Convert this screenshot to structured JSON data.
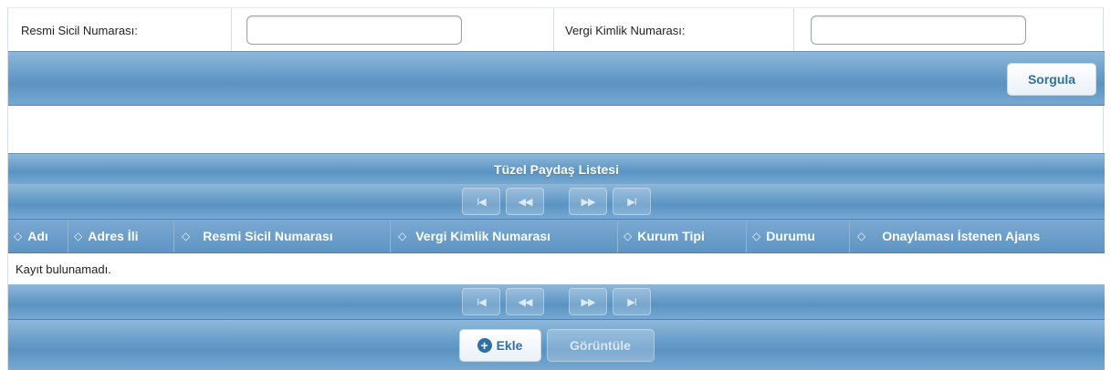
{
  "form": {
    "sicil_label": "Resmi Sicil Numarası:",
    "sicil_value": "",
    "vergi_label": "Vergi Kimlik Numarası:",
    "vergi_value": ""
  },
  "query_bar": {
    "sorgula_label": "Sorgula"
  },
  "list": {
    "title": "Tüzel Paydaş Listesi",
    "pager": {
      "first": "I◀",
      "prev": "◀◀",
      "next": "▶▶",
      "last": "▶I"
    },
    "columns": [
      {
        "label": "Adı",
        "sort_icon": "◇"
      },
      {
        "label": "Adres İli",
        "sort_icon": "◇"
      },
      {
        "label": "Resmi Sicil Numarası",
        "sort_icon": "◇"
      },
      {
        "label": "Vergi Kimlik Numarası",
        "sort_icon": "◇"
      },
      {
        "label": "Kurum Tipi",
        "sort_icon": "◇"
      },
      {
        "label": "Durumu",
        "sort_icon": "◇"
      },
      {
        "label": "Onaylaması İstenen Ajans",
        "sort_icon": "◇"
      }
    ],
    "empty_message": "Kayıt bulunamadı."
  },
  "actions": {
    "add_icon": "+",
    "add_label": "Ekle",
    "view_label": "Görüntüle"
  },
  "colors": {
    "bar": "#6a9fcb",
    "button_text": "#2f6fa8"
  }
}
